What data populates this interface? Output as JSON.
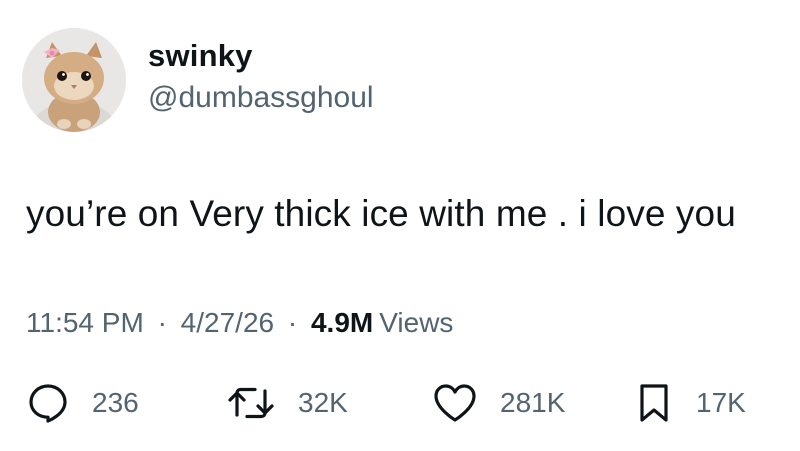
{
  "user": {
    "display_name": "swinky",
    "handle": "@dumbassghoul",
    "avatar_icon": "kitten-avatar"
  },
  "tweet": {
    "text": "you’re on Very thick ice with me . i love you"
  },
  "meta": {
    "time": "11:54 PM",
    "separator": "·",
    "date": "4/27/26",
    "views_count": "4.9M",
    "views_label": "Views"
  },
  "actions": {
    "reply": {
      "icon": "reply-icon",
      "count": "236"
    },
    "retweet": {
      "icon": "retweet-icon",
      "count": "32K"
    },
    "like": {
      "icon": "heart-icon",
      "count": "281K"
    },
    "bookmark": {
      "icon": "bookmark-icon",
      "count": "17K"
    }
  },
  "colors": {
    "text": "#0f1419",
    "secondary": "#536471",
    "background": "#ffffff"
  }
}
